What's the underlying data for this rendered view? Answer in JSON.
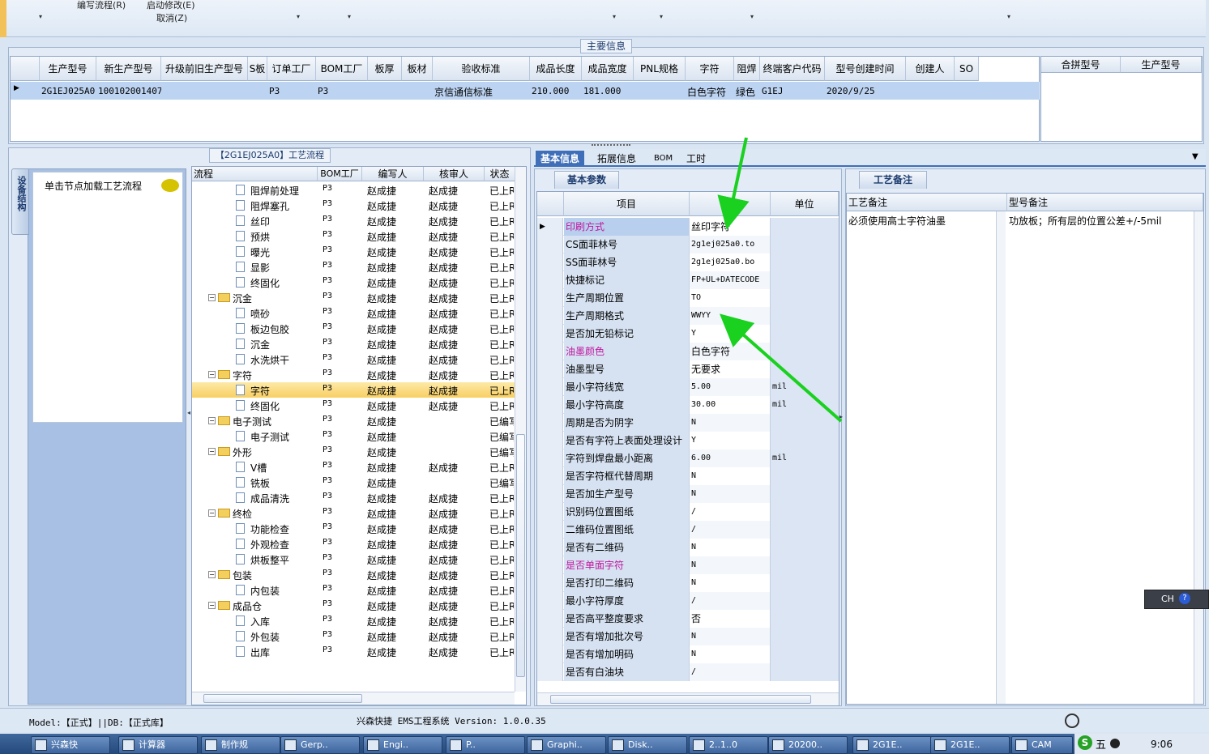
{
  "toolbar": {
    "menu1": "编写流程(R)",
    "menu2": "启动修改(E)",
    "menu3": "取消(Z)",
    "dropdown_marks": [
      "▾",
      "▾",
      "▾",
      "▾",
      "▾",
      "▾",
      "▾"
    ]
  },
  "main_info": {
    "label": "主要信息",
    "columns": [
      "生产型号",
      "新生产型号",
      "升级前旧生产型号",
      "S板",
      "订单工厂",
      "BOM工厂",
      "板厚",
      "板材",
      "验收标准",
      "成品长度",
      "成品宽度",
      "PNL规格",
      "字符",
      "阻焊",
      "终端客户代码",
      "型号创建时间",
      "创建人",
      "SO"
    ],
    "row": [
      "2G1EJ025A0",
      "10010200140793",
      "",
      "",
      "P3",
      "P3",
      "",
      "",
      "京信通信标准",
      "210.000",
      "181.000",
      "",
      "白色字符",
      "绿色",
      "G1EJ",
      "2020/9/25",
      "",
      ""
    ],
    "side_columns": [
      "合拼型号",
      "生产型号"
    ]
  },
  "process": {
    "label": "【2G1EJ025A0】工艺流程",
    "side_tab": "设备结构",
    "hint": "单击节点加载工艺流程",
    "columns": [
      "流程",
      "BOM工厂",
      "编写人",
      "核审人",
      "状态"
    ],
    "rows": [
      {
        "name": "阻焊前处理",
        "level": 2,
        "type": "doc",
        "bom": "P3",
        "writer": "赵成捷",
        "reviewer": "赵成捷",
        "status": "已上R"
      },
      {
        "name": "阻焊塞孔",
        "level": 2,
        "type": "doc",
        "bom": "P3",
        "writer": "赵成捷",
        "reviewer": "赵成捷",
        "status": "已上R"
      },
      {
        "name": "丝印",
        "level": 2,
        "type": "doc",
        "bom": "P3",
        "writer": "赵成捷",
        "reviewer": "赵成捷",
        "status": "已上R"
      },
      {
        "name": "预烘",
        "level": 2,
        "type": "doc",
        "bom": "P3",
        "writer": "赵成捷",
        "reviewer": "赵成捷",
        "status": "已上R"
      },
      {
        "name": "曝光",
        "level": 2,
        "type": "doc",
        "bom": "P3",
        "writer": "赵成捷",
        "reviewer": "赵成捷",
        "status": "已上R"
      },
      {
        "name": "显影",
        "level": 2,
        "type": "doc",
        "bom": "P3",
        "writer": "赵成捷",
        "reviewer": "赵成捷",
        "status": "已上R"
      },
      {
        "name": "终固化",
        "level": 2,
        "type": "doc",
        "bom": "P3",
        "writer": "赵成捷",
        "reviewer": "赵成捷",
        "status": "已上R"
      },
      {
        "name": "沉金",
        "level": 1,
        "type": "folder",
        "bom": "P3",
        "writer": "赵成捷",
        "reviewer": "赵成捷",
        "status": "已上R"
      },
      {
        "name": "喷砂",
        "level": 2,
        "type": "doc",
        "bom": "P3",
        "writer": "赵成捷",
        "reviewer": "赵成捷",
        "status": "已上R"
      },
      {
        "name": "板边包胶",
        "level": 2,
        "type": "doc",
        "bom": "P3",
        "writer": "赵成捷",
        "reviewer": "赵成捷",
        "status": "已上R"
      },
      {
        "name": "沉金",
        "level": 2,
        "type": "doc",
        "bom": "P3",
        "writer": "赵成捷",
        "reviewer": "赵成捷",
        "status": "已上R"
      },
      {
        "name": "水洗烘干",
        "level": 2,
        "type": "doc",
        "bom": "P3",
        "writer": "赵成捷",
        "reviewer": "赵成捷",
        "status": "已上R"
      },
      {
        "name": "字符",
        "level": 1,
        "type": "folder",
        "bom": "P3",
        "writer": "赵成捷",
        "reviewer": "赵成捷",
        "status": "已上R"
      },
      {
        "name": "字符",
        "level": 2,
        "type": "doc",
        "bom": "P3",
        "writer": "赵成捷",
        "reviewer": "赵成捷",
        "status": "已上R",
        "selected": true
      },
      {
        "name": "终固化",
        "level": 2,
        "type": "doc",
        "bom": "P3",
        "writer": "赵成捷",
        "reviewer": "赵成捷",
        "status": "已上R"
      },
      {
        "name": "电子测试",
        "level": 1,
        "type": "folder",
        "bom": "P3",
        "writer": "赵成捷",
        "reviewer": "",
        "status": "已编写"
      },
      {
        "name": "电子测试",
        "level": 2,
        "type": "doc",
        "bom": "P3",
        "writer": "赵成捷",
        "reviewer": "",
        "status": "已编写"
      },
      {
        "name": "外形",
        "level": 1,
        "type": "folder",
        "bom": "P3",
        "writer": "赵成捷",
        "reviewer": "",
        "status": "已编写"
      },
      {
        "name": "V槽",
        "level": 2,
        "type": "doc",
        "bom": "P3",
        "writer": "赵成捷",
        "reviewer": "赵成捷",
        "status": "已上R"
      },
      {
        "name": "铣板",
        "level": 2,
        "type": "doc",
        "bom": "P3",
        "writer": "赵成捷",
        "reviewer": "",
        "status": "已编写"
      },
      {
        "name": "成品清洗",
        "level": 2,
        "type": "doc",
        "bom": "P3",
        "writer": "赵成捷",
        "reviewer": "赵成捷",
        "status": "已上R"
      },
      {
        "name": "终检",
        "level": 1,
        "type": "folder",
        "bom": "P3",
        "writer": "赵成捷",
        "reviewer": "赵成捷",
        "status": "已上R"
      },
      {
        "name": "功能检查",
        "level": 2,
        "type": "doc",
        "bom": "P3",
        "writer": "赵成捷",
        "reviewer": "赵成捷",
        "status": "已上R"
      },
      {
        "name": "外观检查",
        "level": 2,
        "type": "doc",
        "bom": "P3",
        "writer": "赵成捷",
        "reviewer": "赵成捷",
        "status": "已上R"
      },
      {
        "name": "烘板整平",
        "level": 2,
        "type": "doc",
        "bom": "P3",
        "writer": "赵成捷",
        "reviewer": "赵成捷",
        "status": "已上R"
      },
      {
        "name": "包装",
        "level": 1,
        "type": "folder",
        "bom": "P3",
        "writer": "赵成捷",
        "reviewer": "赵成捷",
        "status": "已上R"
      },
      {
        "name": "内包装",
        "level": 2,
        "type": "doc",
        "bom": "P3",
        "writer": "赵成捷",
        "reviewer": "赵成捷",
        "status": "已上R"
      },
      {
        "name": "成品仓",
        "level": 1,
        "type": "folder",
        "bom": "P3",
        "writer": "赵成捷",
        "reviewer": "赵成捷",
        "status": "已上R"
      },
      {
        "name": "入库",
        "level": 2,
        "type": "doc",
        "bom": "P3",
        "writer": "赵成捷",
        "reviewer": "赵成捷",
        "status": "已上R"
      },
      {
        "name": "外包装",
        "level": 2,
        "type": "doc",
        "bom": "P3",
        "writer": "赵成捷",
        "reviewer": "赵成捷",
        "status": "已上R"
      },
      {
        "name": "出库",
        "level": 2,
        "type": "doc",
        "bom": "P3",
        "writer": "赵成捷",
        "reviewer": "赵成捷",
        "status": "已上R"
      }
    ]
  },
  "tabs": [
    "基本信息",
    "拓展信息",
    "BOM",
    "工时"
  ],
  "basic": {
    "subtab": "基本参数",
    "columns": [
      "项目",
      "参数",
      "单位"
    ],
    "rows": [
      {
        "name": "印刷方式",
        "value": "丝印字符",
        "unit": "",
        "pink": true
      },
      {
        "name": "CS面菲林号",
        "value": "2g1ej025a0.to",
        "unit": ""
      },
      {
        "name": "SS面菲林号",
        "value": "2g1ej025a0.bo",
        "unit": ""
      },
      {
        "name": "快捷标记",
        "value": "FP+UL+DATECODE",
        "unit": ""
      },
      {
        "name": "生产周期位置",
        "value": "TO",
        "unit": ""
      },
      {
        "name": "生产周期格式",
        "value": "WWYY",
        "unit": ""
      },
      {
        "name": "是否加无铅标记",
        "value": "Y",
        "unit": ""
      },
      {
        "name": "油墨颜色",
        "value": "白色字符",
        "unit": "",
        "pink": true
      },
      {
        "name": "油墨型号",
        "value": "无要求",
        "unit": ""
      },
      {
        "name": "最小字符线宽",
        "value": "5.00",
        "unit": "mil"
      },
      {
        "name": "最小字符高度",
        "value": "30.00",
        "unit": "mil"
      },
      {
        "name": "周期是否为阴字",
        "value": "N",
        "unit": ""
      },
      {
        "name": "是否有字符上表面处理设计",
        "value": "Y",
        "unit": ""
      },
      {
        "name": "字符到焊盘最小距离",
        "value": "6.00",
        "unit": "mil"
      },
      {
        "name": "是否字符框代替周期",
        "value": "N",
        "unit": ""
      },
      {
        "name": "是否加生产型号",
        "value": "N",
        "unit": ""
      },
      {
        "name": "识别码位置图纸",
        "value": "/",
        "unit": ""
      },
      {
        "name": "二维码位置图纸",
        "value": "/",
        "unit": ""
      },
      {
        "name": "是否有二维码",
        "value": "N",
        "unit": ""
      },
      {
        "name": "是否单面字符",
        "value": "N",
        "unit": "",
        "pink": true
      },
      {
        "name": "是否打印二维码",
        "value": "N",
        "unit": ""
      },
      {
        "name": "最小字符厚度",
        "value": "/",
        "unit": ""
      },
      {
        "name": "是否高平整度要求",
        "value": "否",
        "unit": ""
      },
      {
        "name": "是否有增加批次号",
        "value": "N",
        "unit": ""
      },
      {
        "name": "是否有增加明码",
        "value": "N",
        "unit": ""
      },
      {
        "name": "是否有白油块",
        "value": "/",
        "unit": ""
      }
    ]
  },
  "notes": {
    "subtab": "工艺备注",
    "columns": [
      "工艺备注",
      "型号备注"
    ],
    "process_note": "必须使用高士字符油墨",
    "model_note": "功放板；所有层的位置公差+/-5mil"
  },
  "status": {
    "model": "Model:【正式】||DB:【正式库】",
    "system": "兴森快捷 EMS工程系统 Version: 1.0.0.35"
  },
  "ime": {
    "label": "CH"
  },
  "taskbar": {
    "items": [
      "兴森快",
      "计算器",
      "制作规",
      "Gerp..",
      "Engi..",
      "P..",
      "Graphi..",
      "Disk..",
      "2..1..0",
      "20200..",
      "2G1E..",
      "2G1E..",
      "CAM"
    ],
    "clock": "9:06",
    "ime_label": "五"
  },
  "colors": {
    "accent": "#3f6fb8",
    "highlight": "#f8cf63",
    "pink": "#c0189e",
    "arrow": "#19d11e"
  }
}
